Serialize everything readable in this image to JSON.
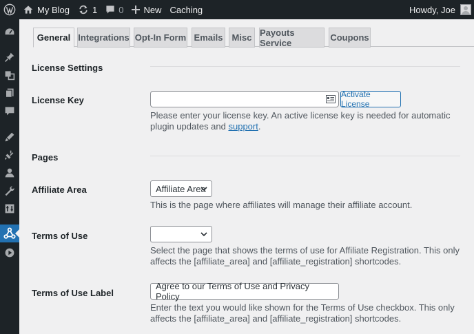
{
  "adminbar": {
    "site_name": "My Blog",
    "updates_count": "1",
    "comments_count": "0",
    "new_label": "New",
    "caching_label": "Caching",
    "greeting": "Howdy, Joe"
  },
  "menu_icons": [
    "dashboard-icon",
    "pin-icon",
    "media-icon",
    "pages-icon",
    "comments-icon",
    "appearance-icon",
    "plugins-icon",
    "users-icon",
    "tools-icon",
    "settings-icon",
    "affiliate-icon",
    "play-icon"
  ],
  "tabs": [
    {
      "label": "General",
      "active": true
    },
    {
      "label": "Integrations"
    },
    {
      "label": "Opt-In Form"
    },
    {
      "label": "Emails"
    },
    {
      "label": "Misc"
    },
    {
      "label": "Payouts Service"
    },
    {
      "label": "Coupons"
    }
  ],
  "license": {
    "section_title": "License Settings",
    "label": "License Key",
    "value": "",
    "button": "Activate License",
    "desc_before": "Please enter your license key. An active license key is needed for automatic plugin updates and ",
    "desc_link": "support",
    "desc_after": "."
  },
  "pages": {
    "section_title": "Pages",
    "affiliate_area": {
      "label": "Affiliate Area",
      "selected": "Affiliate Area",
      "desc": "This is the page where affiliates will manage their affiliate account."
    },
    "terms": {
      "label": "Terms of Use",
      "selected": "",
      "desc": "Select the page that shows the terms of use for Affiliate Registration. This only affects the [affiliate_area] and [affiliate_registration] shortcodes."
    },
    "terms_label": {
      "label": "Terms of Use Label",
      "value": "Agree to our Terms of Use and Privacy Policy",
      "desc": "Enter the text you would like shown for the Terms of Use checkbox. This only affects the [affiliate_area] and [affiliate_registration] shortcodes."
    }
  }
}
